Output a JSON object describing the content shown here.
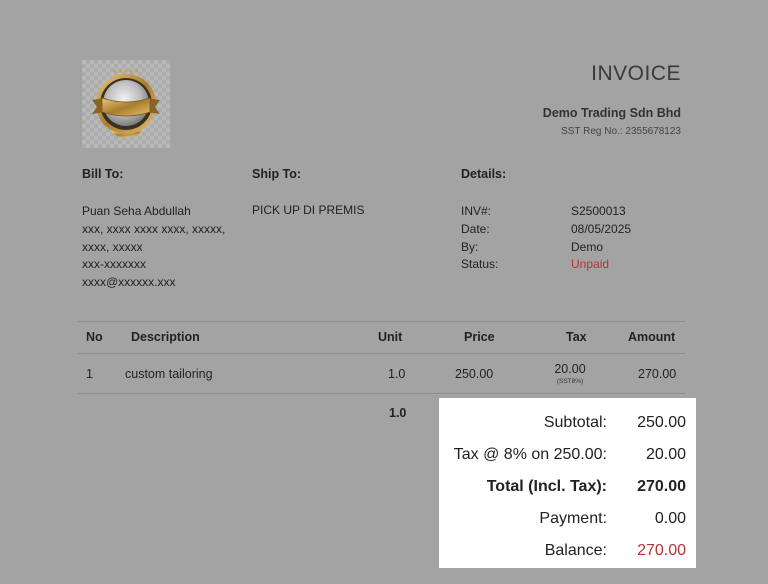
{
  "header": {
    "title": "INVOICE",
    "company": "Demo Trading Sdn Bhd",
    "sst": "SST Reg No.: 2355678123"
  },
  "bill_to": {
    "heading": "Bill To:",
    "lines": [
      "Puan Seha Abdullah",
      "xxx, xxxx xxxx xxxx, xxxxx,",
      "xxxx, xxxxx",
      "xxx-xxxxxxx",
      "xxxx@xxxxxx.xxx"
    ]
  },
  "ship_to": {
    "heading": "Ship To:",
    "text": "PICK UP DI PREMIS"
  },
  "details": {
    "heading": "Details:",
    "labels": [
      "INV#:",
      "Date:",
      "By:",
      "Status:"
    ],
    "values": [
      "S2500013",
      "08/05/2025",
      "Demo",
      "Unpaid"
    ]
  },
  "table": {
    "headers": [
      "No",
      "Description",
      "Unit",
      "Price",
      "Tax",
      "Amount"
    ],
    "rows": [
      {
        "no": "1",
        "description": "custom tailoring",
        "unit": "1.0",
        "price": "250.00",
        "tax": "20.00",
        "tax_note": "(SST8%)",
        "amount": "270.00"
      }
    ],
    "unit_total": "1.0"
  },
  "totals": [
    {
      "label": "Subtotal:",
      "value": "250.00"
    },
    {
      "label": "Tax @ 8% on 250.00:",
      "value": "20.00"
    },
    {
      "label": "Total (Incl. Tax):",
      "value": "270.00"
    },
    {
      "label": "Payment:",
      "value": "0.00"
    },
    {
      "label": "Balance:",
      "value": "270.00"
    }
  ],
  "colors": {
    "accent_red": "#b83232",
    "gold": "#c9a24a"
  }
}
